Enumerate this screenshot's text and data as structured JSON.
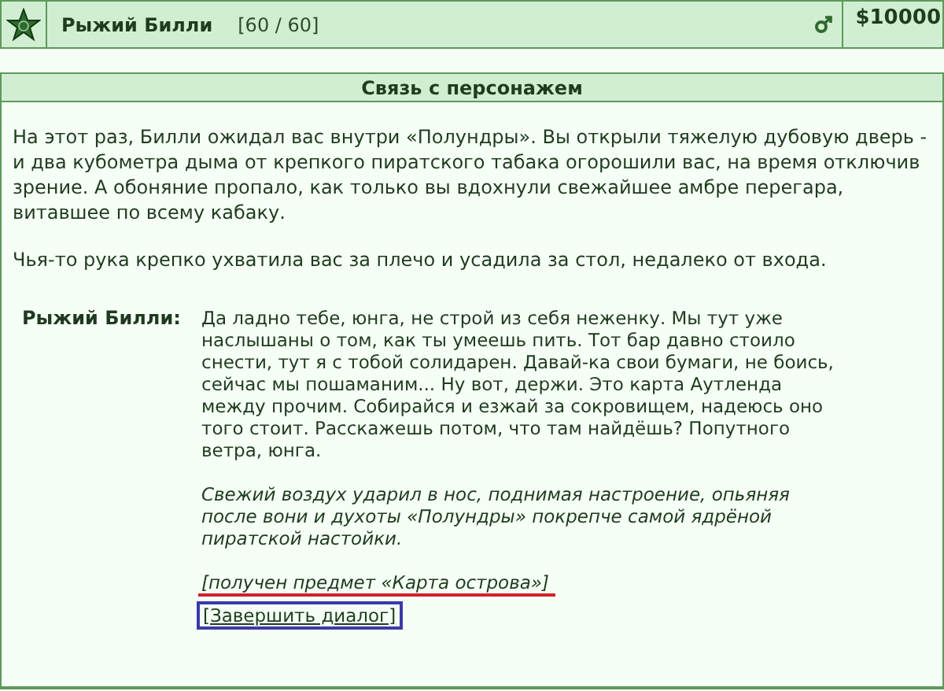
{
  "status_bar": {
    "name": "Рыжий Билли",
    "health": "[60 / 60]",
    "money": "$10000"
  },
  "panel": {
    "title": "Связь с персонажем",
    "paragraphs": [
      "На этот раз, Билли ожидал вас внутри «Полундры». Вы открыли тяжелую дубовую дверь - и два кубометра дыма от крепкого пиратского табака огорошили вас, на время отключив зрение. А обоняние пропало, как только вы вдохнули свежайшее амбре перегара, витавшее по всему кабаку.",
      "Чья-то рука крепко ухватила вас за плечо и усадила за стол, недалеко от входа."
    ],
    "dialogue": {
      "speaker": "Рыжий Билли:",
      "speech": "Да ладно тебе, юнга, не строй из себя неженку. Мы тут уже наслышаны о том, как ты умеешь пить. Тот бар давно стоило снести, тут я с тобой солидарен. Давай-ка свои бумаги, не боись, сейчас мы пошаманим... Ну вот, держи. Это карта Аутленда между прочим. Собирайся и езжай за сокровищем, надеюсь оно того стоит. Расскажешь потом, что там найдёшь? Попутного ветра, юнга.",
      "narration": "Свежий воздух ударил в нос, поднимая настроение, опьяняя после вони и духоты «Полундры» покрепче самой ядрёной пиратской настойки.",
      "item_received": "[получен предмет «Карта острова»]",
      "end_link": "[Завершить диалог]"
    }
  }
}
